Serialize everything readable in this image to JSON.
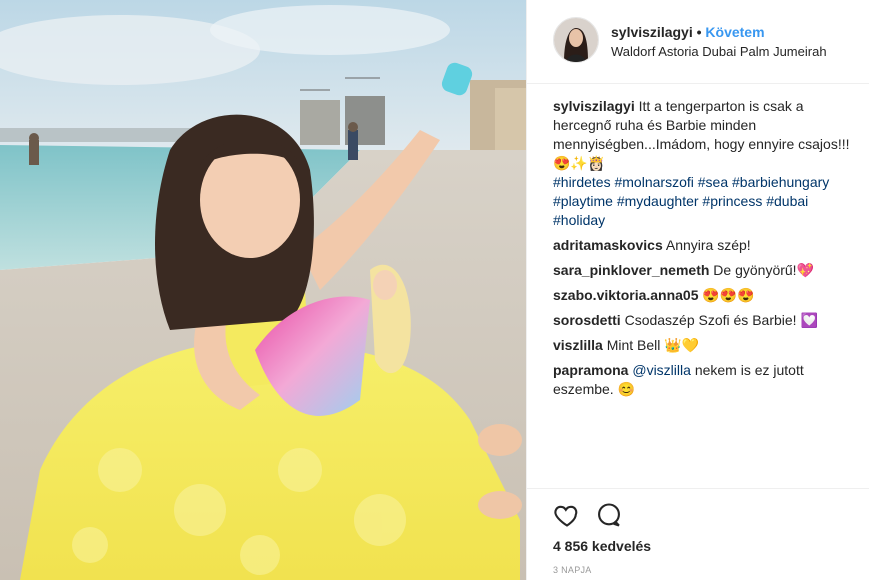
{
  "post": {
    "username": "sylviszilagyi",
    "separator": "•",
    "follow_label": "Követem",
    "location": "Waldorf Astoria Dubai Palm Jumeirah",
    "caption_author": "sylviszilagyi",
    "caption_text": "Itt a tengerparton is csak a hercegnő ruha és Barbie minden mennyiségben...Imádom, hogy ennyire csajos!!! 😍✨👸🏻",
    "hashtags": [
      "#hirdetes",
      "#molnarszofi",
      "#sea",
      "#barbiehungary",
      "#playtime",
      "#mydaughter",
      "#princess",
      "#dubai",
      "#holiday"
    ],
    "comments": [
      {
        "user": "adritamaskovics",
        "text": "Annyira szép!"
      },
      {
        "user": "sara_pinklover_nemeth",
        "text": "De gyönyörű!💖"
      },
      {
        "user": "szabo.viktoria.anna05",
        "text": "😍😍😍"
      },
      {
        "user": "sorosdetti",
        "text": "Csodaszép Szofi és Barbie! 💟"
      },
      {
        "user": "viszlilla",
        "text": "Mint Bell 👑💛"
      },
      {
        "user": "papramona",
        "mention": "@viszlilla",
        "text": "nekem is ez jutott eszembe. 😊"
      }
    ],
    "likes": "4 856 kedvelés",
    "time_ago": "3 NAPJA"
  },
  "photo": {
    "description_icon": "beach-photo"
  }
}
